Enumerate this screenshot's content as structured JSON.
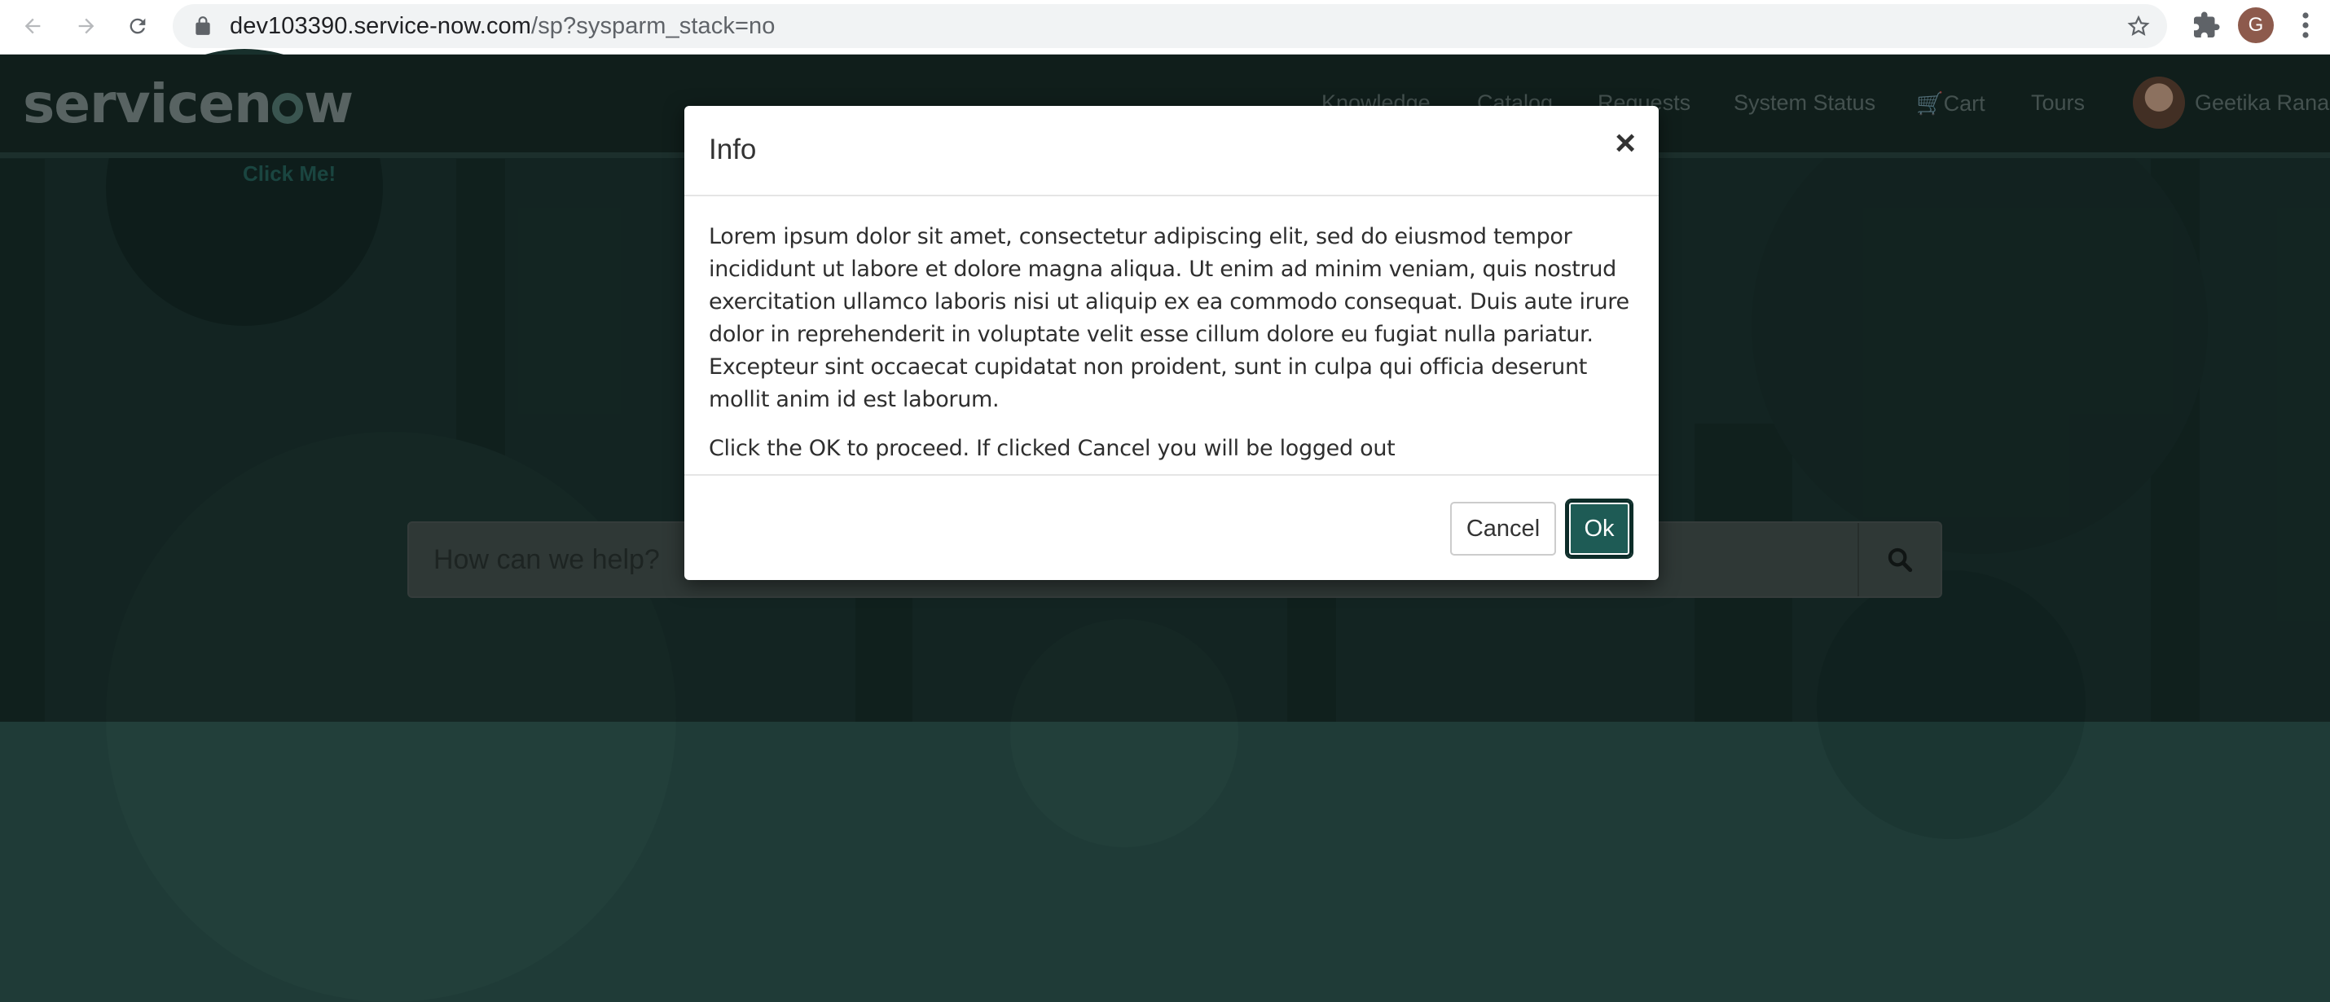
{
  "browser": {
    "url_host": "dev103390.service-now.com",
    "url_path": "/sp?sysparm_stack=no",
    "profile_initial": "G",
    "icons": [
      "back-icon",
      "forward-icon",
      "reload-icon",
      "lock-icon",
      "star-icon",
      "extensions-icon",
      "kebab-menu-icon"
    ]
  },
  "header": {
    "logo_pre": "servicen",
    "logo_post": "w",
    "nav": [
      "Knowledge",
      "Catalog",
      "Requests",
      "System Status",
      "Cart",
      "Tours"
    ],
    "user_name": "Geetika Rana",
    "click_me": "Click Me!"
  },
  "search": {
    "placeholder": "How can we help?"
  },
  "modal": {
    "title": "Info",
    "close_label": "×",
    "body_text": "Lorem ipsum dolor sit amet, consectetur adipiscing elit, sed do eiusmod tempor incididunt ut labore et dolore magna aliqua. Ut enim ad minim veniam, quis nostrud exercitation ullamco laboris nisi ut aliquip ex ea commodo consequat. Duis aute irure dolor in reprehenderit in voluptate velit esse cillum dolore eu fugiat nulla pariatur. Excepteur sint occaecat cupidatat non proident, sunt in culpa qui officia deserunt mollit anim id est laborum.",
    "instruction": "Click the OK to proceed. If clicked Cancel you will be logged out",
    "cancel_label": "Cancel",
    "ok_label": "Ok"
  },
  "colors": {
    "brand_dark": "#1a312d",
    "ok_button": "#1e5b55"
  }
}
